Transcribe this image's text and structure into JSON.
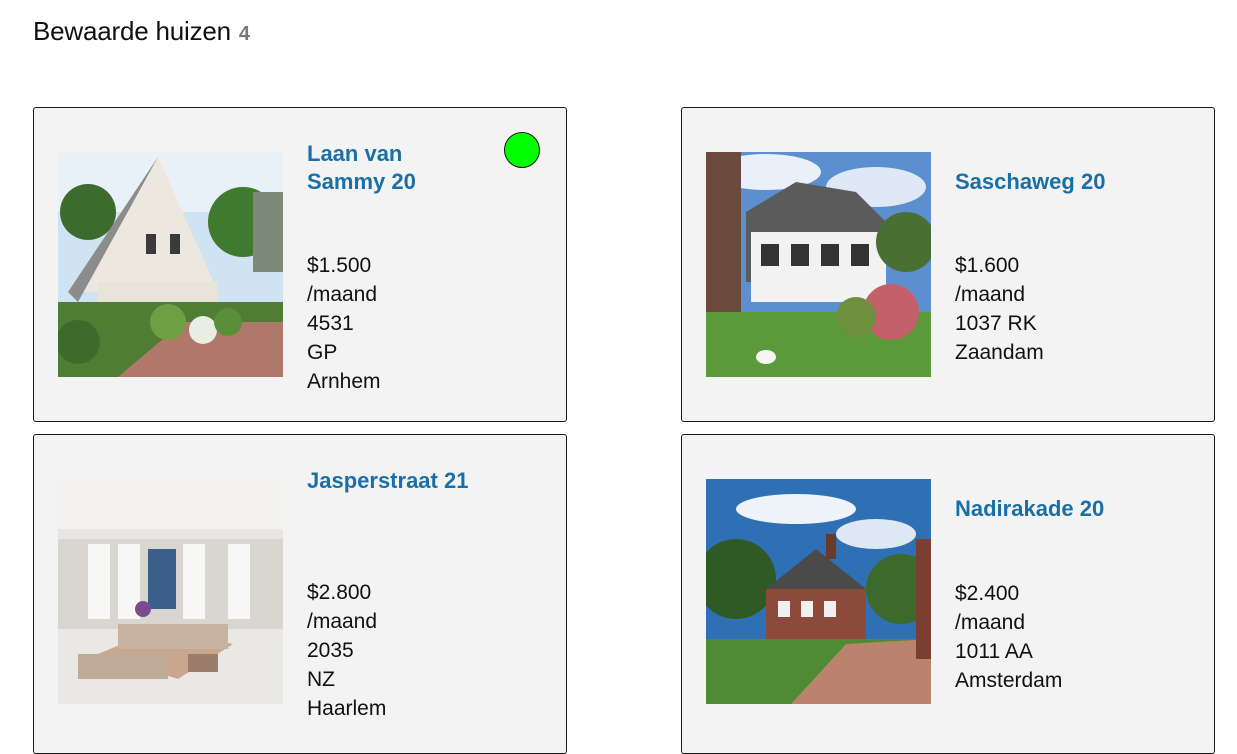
{
  "header": {
    "title": "Bewaarde huizen",
    "count": "4"
  },
  "listings": [
    {
      "street": "Laan van Sammy 20",
      "price": "$1.500",
      "per": "/maand",
      "postcode_num": "4531",
      "postcode_letters": "GP",
      "city": "Arnhem",
      "status_color": "#00ff00"
    },
    {
      "street": "Saschaweg 20",
      "price": "$1.600",
      "per": "/maand",
      "postcode": "1037 RK",
      "city": "Zaandam"
    },
    {
      "street": "Jasperstraat 21",
      "price": "$2.800",
      "per": "/maand",
      "postcode_num": "2035",
      "postcode_letters": "NZ",
      "city": "Haarlem"
    },
    {
      "street": "Nadirakade 20",
      "price": "$2.400",
      "per": "/maand",
      "postcode": "1011 AA",
      "city": "Amsterdam"
    }
  ]
}
